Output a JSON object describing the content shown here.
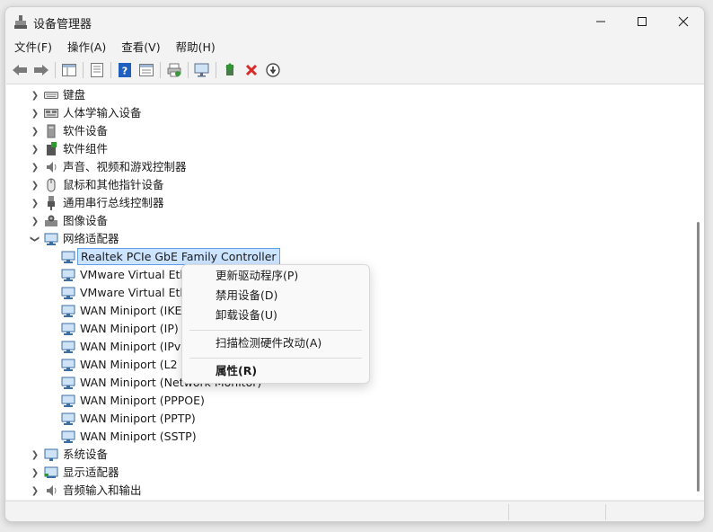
{
  "window": {
    "title": "设备管理器",
    "controls": {
      "minimize": "—",
      "maximize": "☐",
      "close": "✕"
    }
  },
  "menubar": [
    "文件(F)",
    "操作(A)",
    "查看(V)",
    "帮助(H)"
  ],
  "toolbar": {
    "buttons": [
      "back-icon",
      "forward-icon",
      "properties-pane-icon",
      "device-list-icon",
      "help-icon",
      "view-icon",
      "print-icon",
      "monitor-icon",
      "update-driver-icon",
      "uninstall-icon",
      "disable-icon"
    ]
  },
  "tree": {
    "categories": [
      {
        "label": "键盘",
        "icon": "keyboard-icon",
        "expanded": false
      },
      {
        "label": "人体学输入设备",
        "icon": "hid-icon",
        "expanded": false
      },
      {
        "label": "软件设备",
        "icon": "software-device-icon",
        "expanded": false
      },
      {
        "label": "软件组件",
        "icon": "software-component-icon",
        "expanded": false
      },
      {
        "label": "声音、视频和游戏控制器",
        "icon": "speaker-icon",
        "expanded": false
      },
      {
        "label": "鼠标和其他指针设备",
        "icon": "mouse-icon",
        "expanded": false
      },
      {
        "label": "通用串行总线控制器",
        "icon": "usb-icon",
        "expanded": false
      },
      {
        "label": "图像设备",
        "icon": "camera-icon",
        "expanded": false
      },
      {
        "label": "网络适配器",
        "icon": "network-adapter-icon",
        "expanded": true
      }
    ],
    "network_adapters": [
      "Realtek PCIe GbE Family Controller",
      "VMware Virtual Eth",
      "VMware Virtual Eth",
      "WAN Miniport (IKE",
      "WAN Miniport (IP)",
      "WAN Miniport (IPv",
      "WAN Miniport (L2",
      "WAN Miniport (Network Monitor)",
      "WAN Miniport (PPPOE)",
      "WAN Miniport (PPTP)",
      "WAN Miniport (SSTP)"
    ],
    "trailing_categories": [
      {
        "label": "系统设备",
        "icon": "system-device-icon",
        "expanded": false
      },
      {
        "label": "显示适配器",
        "icon": "display-adapter-icon",
        "expanded": false
      },
      {
        "label": "音频输入和输出",
        "icon": "audio-io-icon",
        "expanded": false
      }
    ],
    "selected": "Realtek PCIe GbE Family Controller"
  },
  "context_menu": {
    "items": [
      {
        "label": "更新驱动程序(P)",
        "bold": false
      },
      {
        "label": "禁用设备(D)",
        "bold": false
      },
      {
        "label": "卸载设备(U)",
        "bold": false
      },
      {
        "label": "扫描检测硬件改动(A)",
        "bold": false
      },
      {
        "label": "属性(R)",
        "bold": true
      }
    ]
  },
  "colors": {
    "selection_bg": "#cce4ff",
    "selection_border": "#5f9ee9",
    "close_red": "#d92b2b",
    "help_blue": "#1f5fbf"
  }
}
